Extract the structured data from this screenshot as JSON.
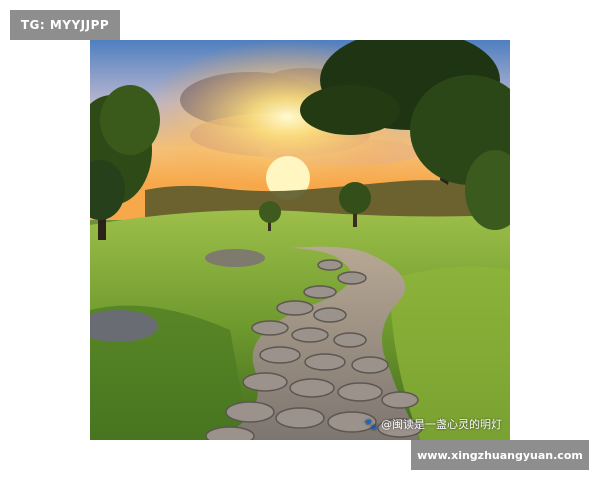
{
  "top_badge": {
    "text": "TG: MYYJJPP"
  },
  "bottom_badge": {
    "text": "www.xingzhuangyuan.com"
  },
  "photo": {
    "watermark_text": "@闽读是一盏心灵的明灯",
    "watermark_icon": "paw-icon"
  },
  "colors": {
    "badge_bg": "#8e8e8e",
    "sky_top": "#5a87c4",
    "sun": "#fff3a0",
    "grass": "#7fa83a",
    "stone": "#8f8a86"
  }
}
